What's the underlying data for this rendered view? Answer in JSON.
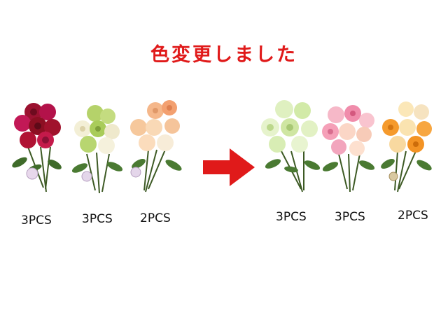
{
  "title": "色変更しました",
  "before": [
    {
      "quantity": "3PCS",
      "colors": [
        "dark-red",
        "magenta"
      ]
    },
    {
      "quantity": "3PCS",
      "colors": [
        "lime-green",
        "cream"
      ]
    },
    {
      "quantity": "2PCS",
      "colors": [
        "peach",
        "salmon"
      ]
    }
  ],
  "after": [
    {
      "quantity": "3PCS",
      "colors": [
        "light-green"
      ]
    },
    {
      "quantity": "3PCS",
      "colors": [
        "pink",
        "peach"
      ]
    },
    {
      "quantity": "2PCS",
      "colors": [
        "orange",
        "cream"
      ]
    }
  ],
  "arrow": {
    "color": "#e01a1a",
    "icon": "right-arrow-icon"
  }
}
